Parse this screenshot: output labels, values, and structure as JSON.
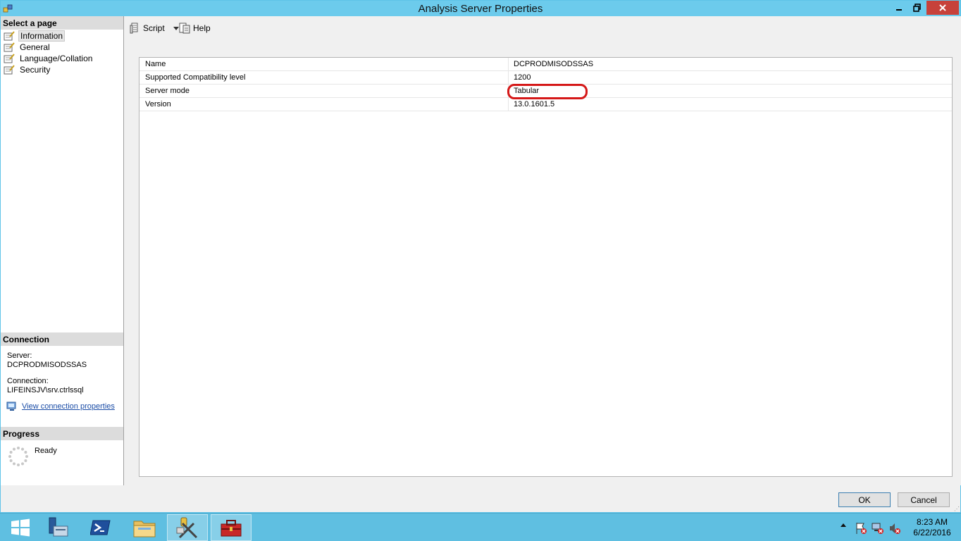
{
  "window": {
    "title": "Analysis Server Properties",
    "minimize": "▁",
    "restore": "⧉",
    "close": "✕"
  },
  "left_pane": {
    "select_page_header": "Select a page",
    "pages": [
      {
        "label": "Information",
        "selected": true
      },
      {
        "label": "General",
        "selected": false
      },
      {
        "label": "Language/Collation",
        "selected": false
      },
      {
        "label": "Security",
        "selected": false
      }
    ],
    "connection_header": "Connection",
    "server_label": "Server:",
    "server_value": "DCPRODMISODSSAS",
    "connection_label": "Connection:",
    "connection_value": "LIFEINSJV\\srv.ctrlssql",
    "view_connection_link": "View connection properties",
    "progress_header": "Progress",
    "progress_status": "Ready"
  },
  "toolbar": {
    "script_label": "Script",
    "help_label": "Help"
  },
  "properties": [
    {
      "name": "Name",
      "value": "DCPRODMISODSSAS"
    },
    {
      "name": "Supported Compatibility level",
      "value": "1200"
    },
    {
      "name": "Server mode",
      "value": "Tabular"
    },
    {
      "name": "Version",
      "value": "13.0.1601.5"
    }
  ],
  "buttons": {
    "ok": "OK",
    "cancel": "Cancel"
  },
  "taskbar": {
    "time": "8:23 AM",
    "date": "6/22/2016",
    "apps": [
      "start-icon",
      "server-manager-icon",
      "powershell-icon",
      "file-explorer-icon",
      "ssms-tools-icon",
      "toolbox-icon"
    ]
  },
  "colors": {
    "titlebar": "#6ccbec",
    "taskbar": "#5fbfe1",
    "highlight": "#d51818",
    "link": "#1a4ca6"
  }
}
